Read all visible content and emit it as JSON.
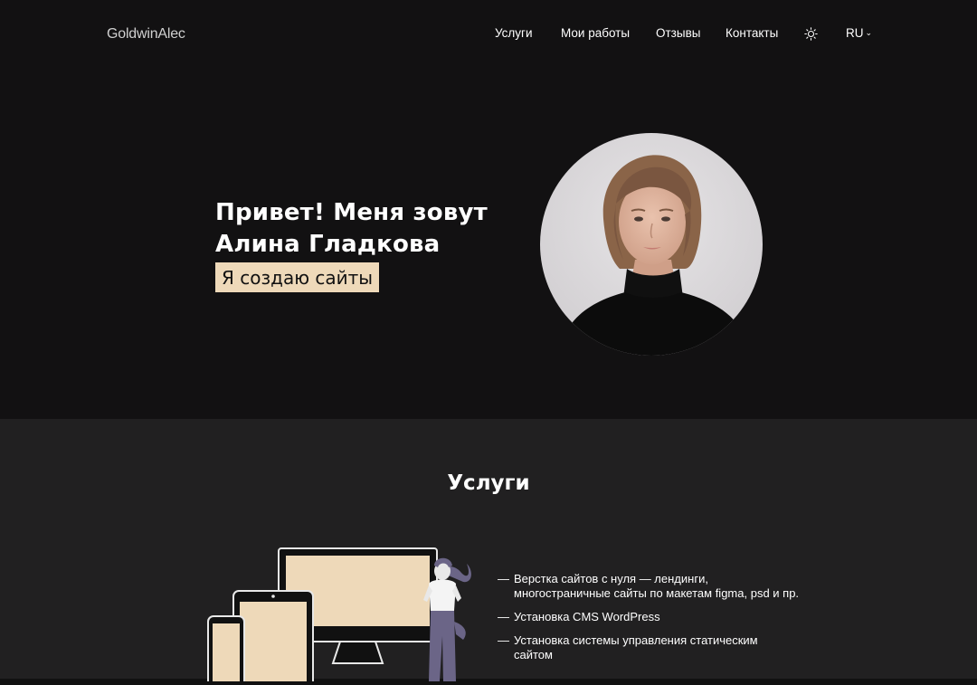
{
  "header": {
    "logo": "GoldwinAlec",
    "nav": [
      {
        "label": "Услуги"
      },
      {
        "label": "Мои работы"
      },
      {
        "label": "Отзывы"
      },
      {
        "label": "Контакты"
      }
    ],
    "theme_toggle_icon": "sun-icon",
    "language": {
      "selected": "RU",
      "icon": "chevron-down-icon"
    }
  },
  "hero": {
    "title_line1": "Привет! Меня зовут",
    "title_line2": "Алина Гладкова",
    "subtitle": "Я создаю сайты",
    "portrait_icon": "portrait-photo"
  },
  "services": {
    "title": "Услуги",
    "illustration_icon": "devices-illustration",
    "items": [
      {
        "dash": "—",
        "line1": "Верстка сайтов с нуля — лендинги,",
        "line2": "многостраничные сайты по макетам figma, psd и пр."
      },
      {
        "dash": "—",
        "line1": "Установка CMS WordPress",
        "line2": ""
      },
      {
        "dash": "—",
        "line1": "Установка системы управления статическим",
        "line2": "сайтом"
      }
    ]
  },
  "colors": {
    "hero_bg": "#121112",
    "services_bg": "#212021",
    "accent": "#eed9b9",
    "figure_purple": "#6b6587"
  }
}
